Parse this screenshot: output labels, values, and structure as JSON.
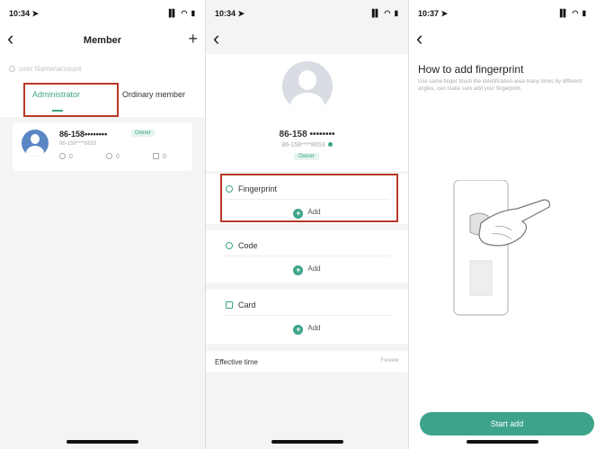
{
  "screen1": {
    "status": {
      "time": "10:34 ➤",
      "icons": "▐▌ ◠ ▮"
    },
    "back": "‹",
    "title": "Member",
    "add": "+",
    "search_placeholder": "user Name/account",
    "tabs": [
      {
        "label": "Administrator",
        "active": true
      },
      {
        "label": "Ordinary member",
        "active": false
      }
    ],
    "member": {
      "name": "86-158••••••••",
      "badge": "Owner",
      "account": "86-158****8653",
      "fingerprint_count": "0",
      "code_count": "0",
      "card_count": "0"
    }
  },
  "screen2": {
    "status": {
      "time": "10:34 ➤",
      "icons": "▐▌ ◠ ▮"
    },
    "back": "‹",
    "profile": {
      "name": "86-158 ••••••••",
      "account": "86-158****8653",
      "badge": "Owner"
    },
    "sections": [
      {
        "title": "Fingerprint",
        "add": "Add",
        "icon": "fingerprint-icon"
      },
      {
        "title": "Code",
        "add": "Add",
        "icon": "code-icon"
      },
      {
        "title": "Card",
        "add": "Add",
        "icon": "card-icon"
      }
    ],
    "effective_time": {
      "label": "Effective time",
      "value": "Forever"
    }
  },
  "screen3": {
    "status": {
      "time": "10:37 ➤",
      "icons": "▐▌ ◠ ▮"
    },
    "back": "‹",
    "title": "How to add fingerprint",
    "description": "Use same finger touch the identification area many times by different angles, can make sure add your fingerprint.",
    "button": "Start add"
  },
  "colors": {
    "accent": "#3da48a",
    "highlight": "#b83a26"
  }
}
